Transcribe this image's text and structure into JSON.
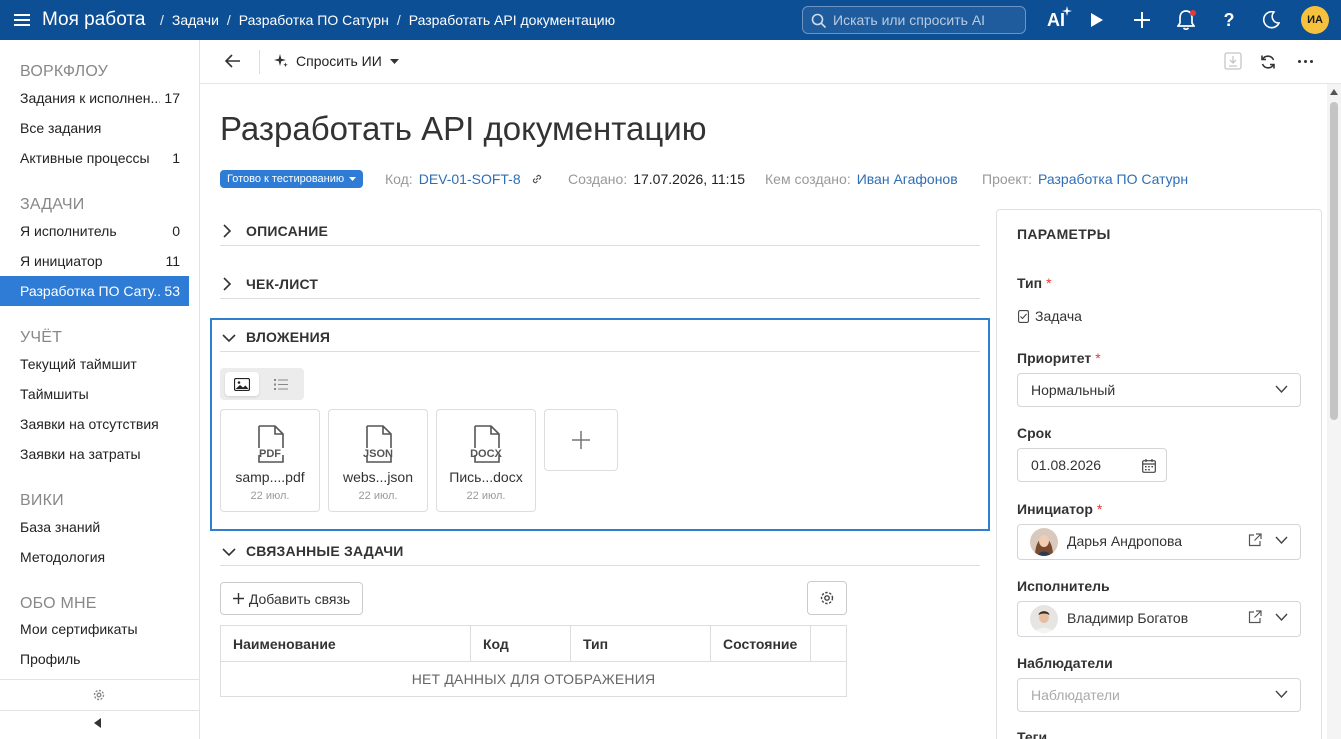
{
  "topbar": {
    "app_title": "Моя работа",
    "breadcrumbs": [
      "Задачи",
      "Разработка ПО Сатурн",
      "Разработать API документацию"
    ],
    "search_placeholder": "Искать или спросить AI",
    "ai_label": "AI",
    "user_initials": "ИА",
    "icons": [
      "menu-icon",
      "search-icon",
      "ai-sparkle-icon",
      "play-icon",
      "plus-icon",
      "bell-icon",
      "help-icon",
      "moon-icon"
    ]
  },
  "sidebar": {
    "groups": [
      {
        "title": "ВОРКФЛОУ",
        "items": [
          {
            "label": "Задания к исполнен...",
            "count": "17"
          },
          {
            "label": "Все задания",
            "count": ""
          },
          {
            "label": "Активные процессы",
            "count": "1"
          }
        ]
      },
      {
        "title": "ЗАДАЧИ",
        "items": [
          {
            "label": "Я исполнитель",
            "count": "0"
          },
          {
            "label": "Я инициатор",
            "count": "11"
          },
          {
            "label": "Разработка ПО Сату...",
            "count": "53",
            "active": true
          }
        ]
      },
      {
        "title": "УЧЁТ",
        "items": [
          {
            "label": "Текущий таймшит",
            "count": ""
          },
          {
            "label": "Таймшиты",
            "count": ""
          },
          {
            "label": "Заявки на отсутствия",
            "count": ""
          },
          {
            "label": "Заявки на затраты",
            "count": ""
          }
        ]
      },
      {
        "title": "ВИКИ",
        "items": [
          {
            "label": "База знаний",
            "count": ""
          },
          {
            "label": "Методология",
            "count": ""
          }
        ]
      },
      {
        "title": "ОБО МНЕ",
        "items": [
          {
            "label": "Мои сертификаты",
            "count": ""
          },
          {
            "label": "Профиль",
            "count": ""
          }
        ]
      }
    ]
  },
  "toolbar": {
    "ask_ai_label": "Спросить ИИ"
  },
  "task": {
    "title": "Разработать API документацию",
    "status": "Готово к тестированию",
    "code_label": "Код:",
    "code": "DEV-01-SOFT-8",
    "created_label": "Создано:",
    "created": "17.07.2026, 11:15",
    "author_label": "Кем создано:",
    "author": "Иван Агафонов",
    "project_label": "Проект:",
    "project": "Разработка ПО Сатурн"
  },
  "sections": {
    "description": "ОПИСАНИЕ",
    "checklist": "ЧЕК-ЛИСТ",
    "attachments": "ВЛОЖЕНИЯ",
    "related": "СВЯЗАННЫЕ ЗАДАЧИ"
  },
  "attachments": [
    {
      "type": "PDF",
      "name": "samp....pdf",
      "date": "22 июл."
    },
    {
      "type": "JSON",
      "name": "webs...json",
      "date": "22 июл."
    },
    {
      "type": "DOCX",
      "name": "Пись...docx",
      "date": "22 июл."
    }
  ],
  "related": {
    "add_button": "Добавить связь",
    "columns": [
      "Наименование",
      "Код",
      "Тип",
      "Состояние"
    ],
    "empty_text": "НЕТ ДАННЫХ ДЛЯ ОТОБРАЖЕНИЯ"
  },
  "params": {
    "title": "ПАРАМЕТРЫ",
    "type_label": "Тип",
    "type_value": "Задача",
    "priority_label": "Приоритет",
    "priority_value": "Нормальный",
    "due_label": "Срок",
    "due_value": "01.08.2026",
    "initiator_label": "Инициатор",
    "initiator_value": "Дарья Андропова",
    "assignee_label": "Исполнитель",
    "assignee_value": "Владимир Богатов",
    "watchers_label": "Наблюдатели",
    "watchers_placeholder": "Наблюдатели",
    "tags_label": "Теги",
    "required_mark": "*"
  },
  "colors": {
    "topbar": "#0d4f95",
    "accent": "#2e7cd6",
    "highlight_border": "#2f7fd1",
    "avatar": "#f6c23e"
  }
}
